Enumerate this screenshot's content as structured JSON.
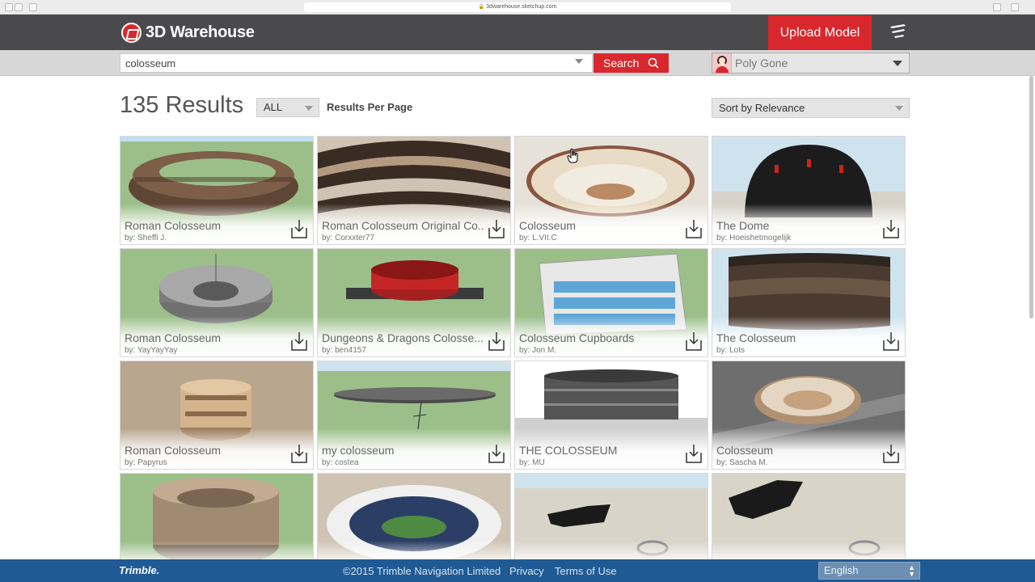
{
  "browser": {
    "url": "3dwarehouse.sketchup.com"
  },
  "header": {
    "logo_text": "3D Warehouse",
    "upload_label": "Upload Model"
  },
  "search": {
    "value": "colosseum",
    "button_label": "Search"
  },
  "user": {
    "name": "Poly Gone"
  },
  "results": {
    "count_label": "135 Results",
    "per_page_value": "ALL",
    "per_page_label": "Results Per Page",
    "sort_value": "Sort by Relevance"
  },
  "models": [
    {
      "title": "Roman Colosseum",
      "author": "by: Sheffi J."
    },
    {
      "title": "Roman Colosseum Original Co...",
      "author": "by: Corxxter77"
    },
    {
      "title": "Colosseum",
      "author": "by: L.VII.C"
    },
    {
      "title": "The Dome",
      "author": "by: Hoeishetmogelijk"
    },
    {
      "title": "Roman Colosseum",
      "author": "by: YayYayYay"
    },
    {
      "title": "Dungeons & Dragons Colosse...",
      "author": "by: ben4157"
    },
    {
      "title": "Colosseum Cupboards",
      "author": "by: Jon M."
    },
    {
      "title": "The Colosseum",
      "author": "by: Lots"
    },
    {
      "title": "Roman Colosseum",
      "author": "by: Papyrus"
    },
    {
      "title": "my colosseum",
      "author": "by: costea"
    },
    {
      "title": "THE COLOSSEUM",
      "author": "by: MU"
    },
    {
      "title": "Colosseum",
      "author": "by: Sascha M."
    },
    {
      "title": "",
      "author": ""
    },
    {
      "title": "",
      "author": ""
    },
    {
      "title": "",
      "author": ""
    },
    {
      "title": "",
      "author": ""
    }
  ],
  "footer": {
    "brand": "Trimble.",
    "copyright": "©2015 Trimble Navigation Limited",
    "privacy": "Privacy",
    "terms": "Terms of Use",
    "language": "English"
  },
  "colors": {
    "accent": "#d9272e",
    "header": "#4a4a4d",
    "footer": "#1f5a94"
  }
}
